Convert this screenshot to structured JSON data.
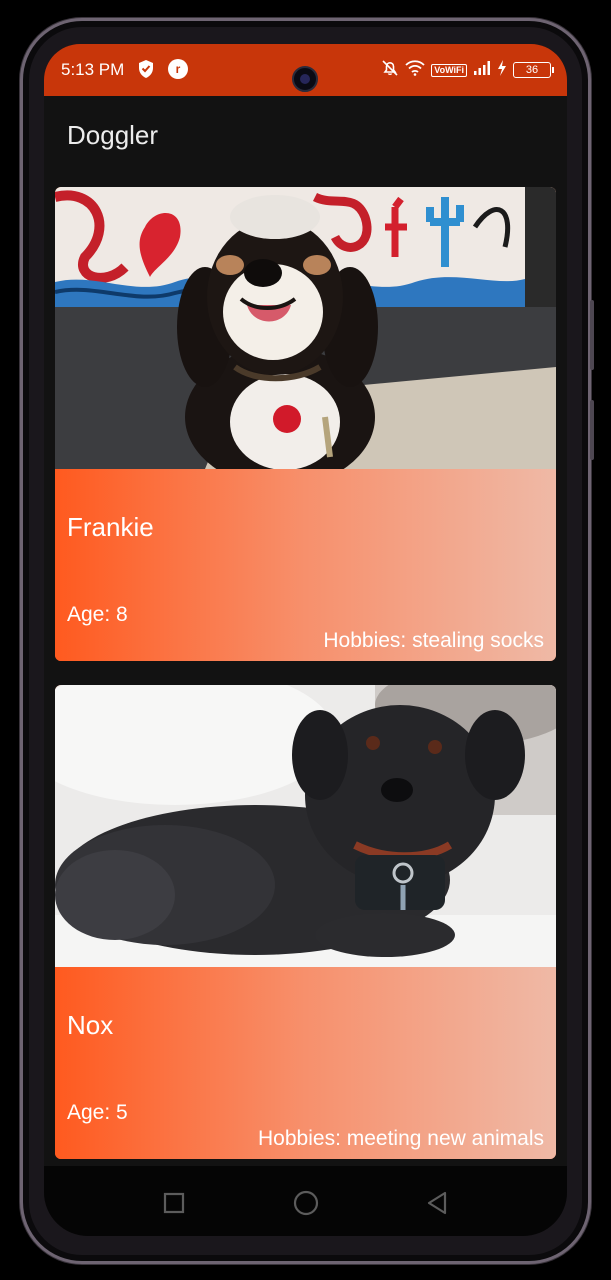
{
  "status_bar": {
    "time": "5:13 PM",
    "vowifi": "VoWiFi",
    "battery": "36",
    "bg_color": "#c8360a"
  },
  "app_bar": {
    "title": "Doggler"
  },
  "dogs": [
    {
      "name": "Frankie",
      "age": "Age: 8",
      "hobbies": "Hobbies: stealing socks"
    },
    {
      "name": "Nox",
      "age": "Age: 5",
      "hobbies": "Hobbies: meeting new animals"
    }
  ],
  "icons": {
    "status_left": [
      "shield-icon",
      "app-badge-icon"
    ],
    "status_right": [
      "bell-off-icon",
      "wifi-icon",
      "signal-icon",
      "charging-icon",
      "battery-icon"
    ],
    "nav": [
      "recents-square-icon",
      "home-circle-icon",
      "back-triangle-icon"
    ]
  },
  "colors": {
    "accent": "#ff5a1f",
    "gradient_end": "#efb9a6",
    "background": "#121212"
  }
}
